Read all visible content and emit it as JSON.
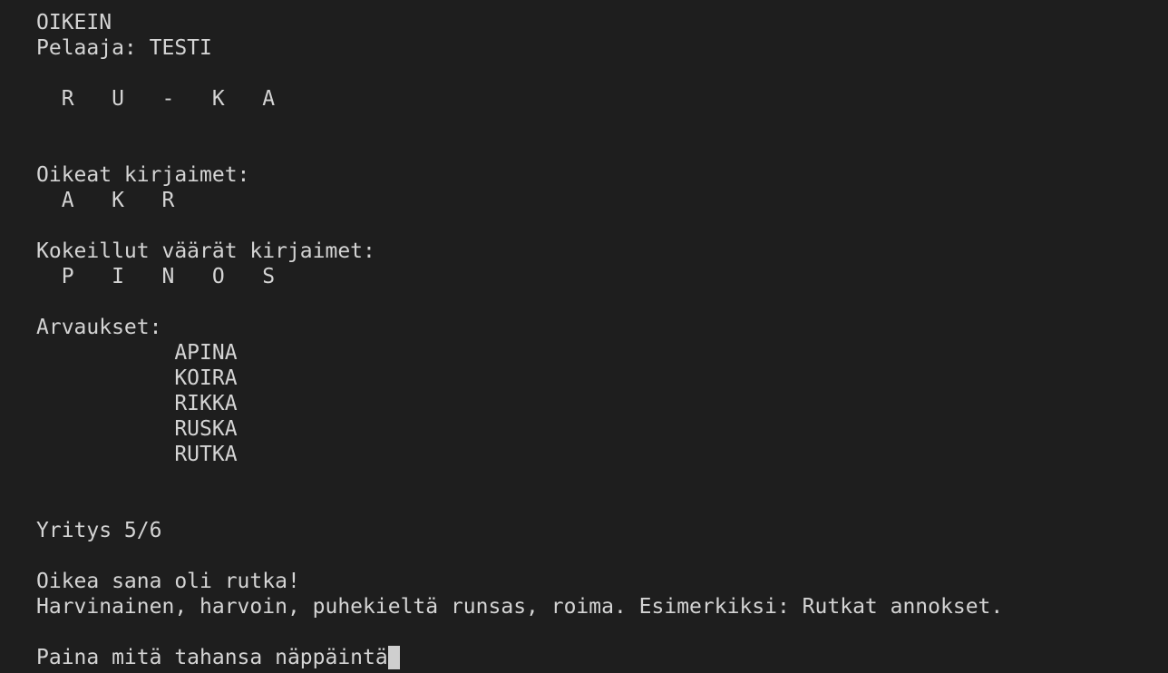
{
  "status": "OIKEIN",
  "player_line": "Pelaaja: TESTI",
  "word_pattern": "  R   U   -   K   A",
  "correct_letters_header": "Oikeat kirjaimet:",
  "correct_letters": "  A   K   R",
  "wrong_letters_header": "Kokeillut väärät kirjaimet:",
  "wrong_letters": "  P   I   N   O   S",
  "guesses_header": "Arvaukset:",
  "guesses": [
    "           APINA",
    "           KOIRA",
    "           RIKKA",
    "           RUSKA",
    "           RUTKA"
  ],
  "attempt_line": "Yritys 5/6",
  "answer_line": "Oikea sana oli rutka!",
  "definition_line": "Harvinainen, harvoin, puhekieltä runsas, roima. Esimerkiksi: Rutkat annokset.",
  "prompt_line": "Paina mitä tahansa näppäintä",
  "colors": {
    "background": "#1e1e1e",
    "text": "#d4d4d4",
    "cursor": "#cfcfcf"
  }
}
